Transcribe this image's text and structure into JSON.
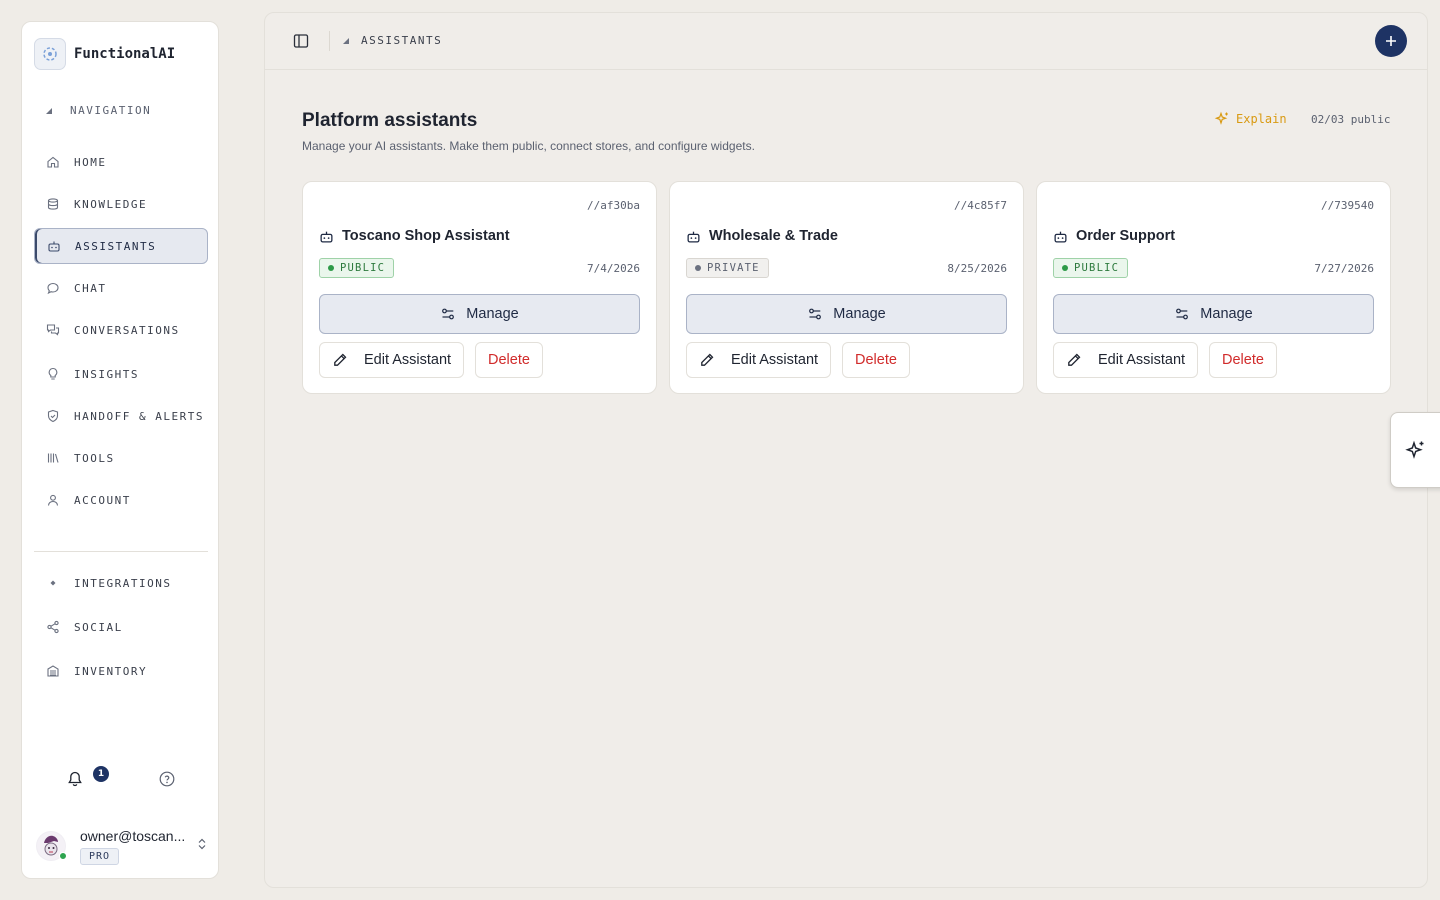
{
  "app": {
    "name": "FunctionalAI"
  },
  "sidebar": {
    "section_label": "NAVIGATION",
    "items": [
      {
        "label": "HOME",
        "icon": "home-icon"
      },
      {
        "label": "KNOWLEDGE",
        "icon": "database-icon"
      },
      {
        "label": "ASSISTANTS",
        "icon": "bot-icon",
        "active": true
      },
      {
        "label": "CHAT",
        "icon": "chat-icon"
      },
      {
        "label": "CONVERSATIONS",
        "icon": "conversations-icon"
      },
      {
        "label": "INSIGHTS",
        "icon": "lightbulb-icon"
      },
      {
        "label": "HANDOFF & ALERTS",
        "icon": "shield-icon"
      },
      {
        "label": "TOOLS",
        "icon": "library-icon"
      },
      {
        "label": "ACCOUNT",
        "icon": "user-icon"
      }
    ],
    "secondary": [
      {
        "label": "INTEGRATIONS",
        "icon": "diamond-icon"
      },
      {
        "label": "SOCIAL",
        "icon": "share-icon"
      },
      {
        "label": "INVENTORY",
        "icon": "inventory-icon"
      }
    ],
    "notifications_count": "1",
    "user": {
      "email": "owner@toscan...",
      "plan": "PRO"
    }
  },
  "topbar": {
    "breadcrumb": "ASSISTANTS"
  },
  "page": {
    "title": "Platform assistants",
    "subtitle": "Manage your AI assistants. Make them public, connect stores, and configure widgets.",
    "explain_label": "Explain",
    "public_count": "02/03 public"
  },
  "assistants": [
    {
      "id": "//af30ba",
      "name": "Toscano Shop Assistant",
      "status": "PUBLIC",
      "date": "7/4/2026",
      "manage": "Manage",
      "edit": "Edit Assistant",
      "delete": "Delete"
    },
    {
      "id": "//4c85f7",
      "name": "Wholesale & Trade",
      "status": "PRIVATE",
      "date": "8/25/2026",
      "manage": "Manage",
      "edit": "Edit Assistant",
      "delete": "Delete"
    },
    {
      "id": "//739540",
      "name": "Order Support",
      "status": "PUBLIC",
      "date": "7/27/2026",
      "manage": "Manage",
      "edit": "Edit Assistant",
      "delete": "Delete"
    }
  ],
  "colors": {
    "accent": "#1e3364",
    "explain": "#d99a12",
    "public": "#2d7a3d",
    "danger": "#d12b2b"
  }
}
